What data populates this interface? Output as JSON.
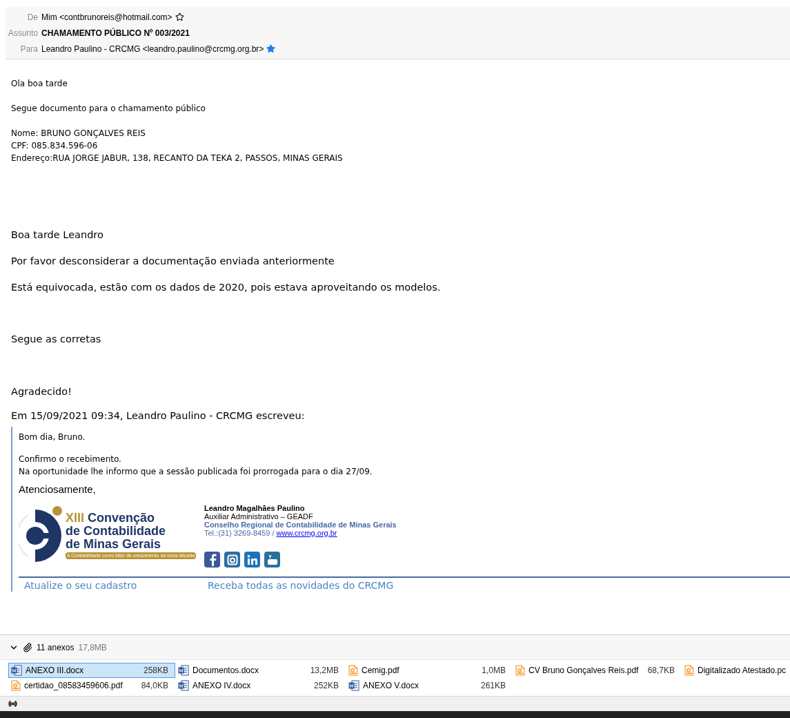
{
  "header": {
    "fields": [
      {
        "label": "De",
        "value": "Mim <contbrunoreis@hotmail.com>",
        "bold": false,
        "star": {
          "starred": false
        }
      },
      {
        "label": "Assunto",
        "value": "CHAMAMENTO PÚBLICO Nº 003/2021",
        "bold": true
      },
      {
        "label": "Para",
        "value": "Leandro Paulino - CRCMG <leandro.paulino@crcmg.org.br>",
        "bold": false,
        "star": {
          "starred": true
        }
      }
    ]
  },
  "body": {
    "small_paragraphs": [
      [
        "Ola boa tarde"
      ],
      [
        "Segue documento para o chamamento público"
      ],
      [
        "Nome:  BRUNO GONÇALVES REIS",
        "CPF: 085.834.596-06",
        "Endereço:RUA JORGE JABUR, 138, RECANTO DA TEKA 2, PASSOS, MINAS GERAIS"
      ]
    ],
    "large_paragraphs": [
      "Boa tarde Leandro",
      "Por favor desconsiderar a documentação enviada anteriormente",
      "Está equivocada, estão com os dados de 2020, pois estava aproveitando os modelos.",
      "Segue as corretas",
      "Agradecido!"
    ],
    "quote_intro": "Em 15/09/2021 09:34, Leandro Paulino - CRCMG escreveu:",
    "quote": {
      "greeting": "Bom dia, Bruno.",
      "lines": [
        "Confirmo o recebimento.",
        "Na oportunidade lhe informo que a sessão publicada foi prorrogada para o dia 27/09."
      ],
      "closing": "Atenciosamente,",
      "logo": {
        "edition": "XIII",
        "title_1": "Convenção",
        "title_2": "de Contabilidade",
        "title_3": "de Minas Gerais",
        "tagline": "A Contabilidade como fator de crescimento na nova década"
      },
      "signature": {
        "name": "Leandro Magalhães Paulino",
        "role": "Auxiliar Administrativo – GEADF",
        "org": "Conselho Regional de Contabilidade de Minas Gerais",
        "phone": "Tel.:(31) 3269-8459 /",
        "link": "www.crcmg.org.br"
      },
      "footer_links": [
        "Atualize o seu cadastro",
        "Receba todas as novidades do CRCMG"
      ]
    }
  },
  "attachments": {
    "expanded": true,
    "count": "11 anexos",
    "size": "17,8MB",
    "files": [
      {
        "kind": "docx",
        "name": "ANEXO III.docx",
        "size": "258KB",
        "selected": true
      },
      {
        "kind": "docx",
        "name": "Documentos.docx",
        "size": "13,2MB",
        "selected": false
      },
      {
        "kind": "pdf",
        "name": "Cemig.pdf",
        "size": "1,0MB",
        "selected": false
      },
      {
        "kind": "pdf",
        "name": "CV Bruno Gonçalves Reis.pdf",
        "size": "68,7KB",
        "selected": false
      },
      {
        "kind": "pdf",
        "name": "Digitalizado Atestado.pc",
        "selected": false
      },
      {
        "kind": "pdf",
        "name": "certidao_08583459606.pdf",
        "size": "84,0KB",
        "selected": false
      },
      {
        "kind": "docx",
        "name": "ANEXO IV.docx",
        "size": "252KB",
        "selected": false
      },
      {
        "kind": "docx",
        "name": "ANEXO V.docx",
        "size": "261KB",
        "selected": false
      }
    ]
  }
}
